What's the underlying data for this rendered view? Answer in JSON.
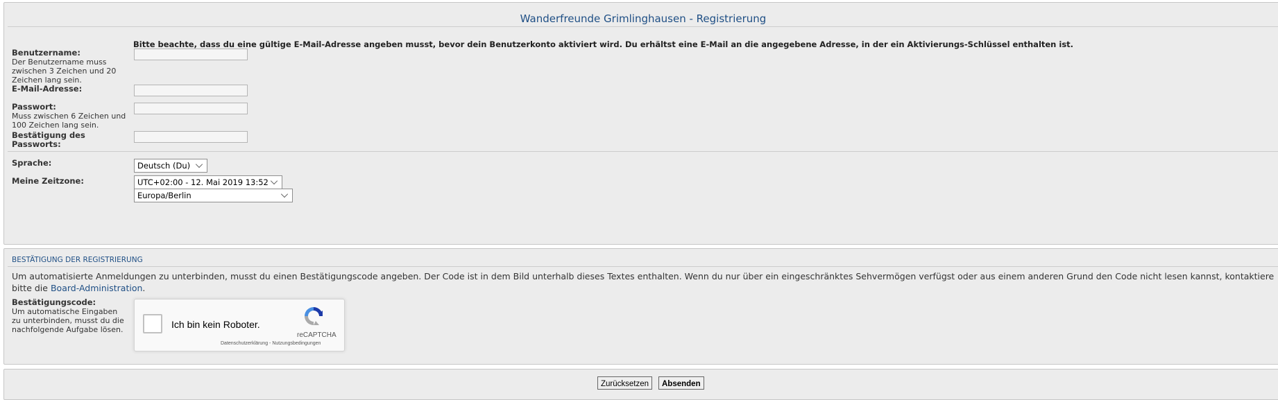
{
  "page": {
    "title": "Wanderfreunde Grimlinghausen - Registrierung"
  },
  "form": {
    "notice": "Bitte beachte, dass du eine gültige E-Mail-Adresse angeben musst, bevor dein Benutzerkonto aktiviert wird. Du erhältst eine E-Mail an die angegebene Adresse, in der ein Aktivierungs-Schlüssel enthalten ist.",
    "username": {
      "label": "Benutzername:",
      "explain": "Der Benutzername muss zwischen 3 Zeichen und 20 Zeichen lang sein.",
      "value": ""
    },
    "email": {
      "label": "E-Mail-Adresse:",
      "value": ""
    },
    "password": {
      "label": "Passwort:",
      "explain": "Muss zwischen 6 Zeichen und 100 Zeichen lang sein.",
      "value": ""
    },
    "password_confirm": {
      "label": "Bestätigung des Passworts:",
      "value": ""
    },
    "language": {
      "label": "Sprache:",
      "selected": "Deutsch (Du)"
    },
    "timezone": {
      "label": "Meine Zeitzone:",
      "offset_selected": "UTC+02:00 - 12. Mai 2019 13:52",
      "zone_selected": "Europa/Berlin"
    }
  },
  "confirmation": {
    "heading": "BESTÄTIGUNG DER REGISTRIERUNG",
    "text": "Um automatisierte Anmeldungen zu unterbinden, musst du einen Bestätigungscode angeben. Der Code ist in dem Bild unterhalb dieses Textes enthalten. Wenn du nur über ein eingeschränktes Sehvermögen verfügst oder aus einem anderen Grund den Code nicht lesen kannst, kontaktiere bitte die",
    "link_text": "Board-Administration",
    "link_suffix": ".",
    "code_label": "Bestätigungscode:",
    "code_explain": "Um automatische Eingaben zu unterbinden, musst du die nachfolgende Aufgabe lösen.",
    "recaptcha": {
      "checkbox_label": "Ich bin kein Roboter.",
      "brand": "reCAPTCHA",
      "privacy": "Datenschutzerklärung",
      "separator": " - ",
      "terms": "Nutzungsbedingungen"
    }
  },
  "buttons": {
    "reset": "Zurücksetzen",
    "submit": "Absenden"
  },
  "colors": {
    "panel_bg": "#ececec",
    "heading_blue": "#1f4f85",
    "recaptcha_blue": "#1c3aa9",
    "recaptcha_light": "#4a90e2",
    "recaptcha_gray": "#aaaaaa"
  }
}
